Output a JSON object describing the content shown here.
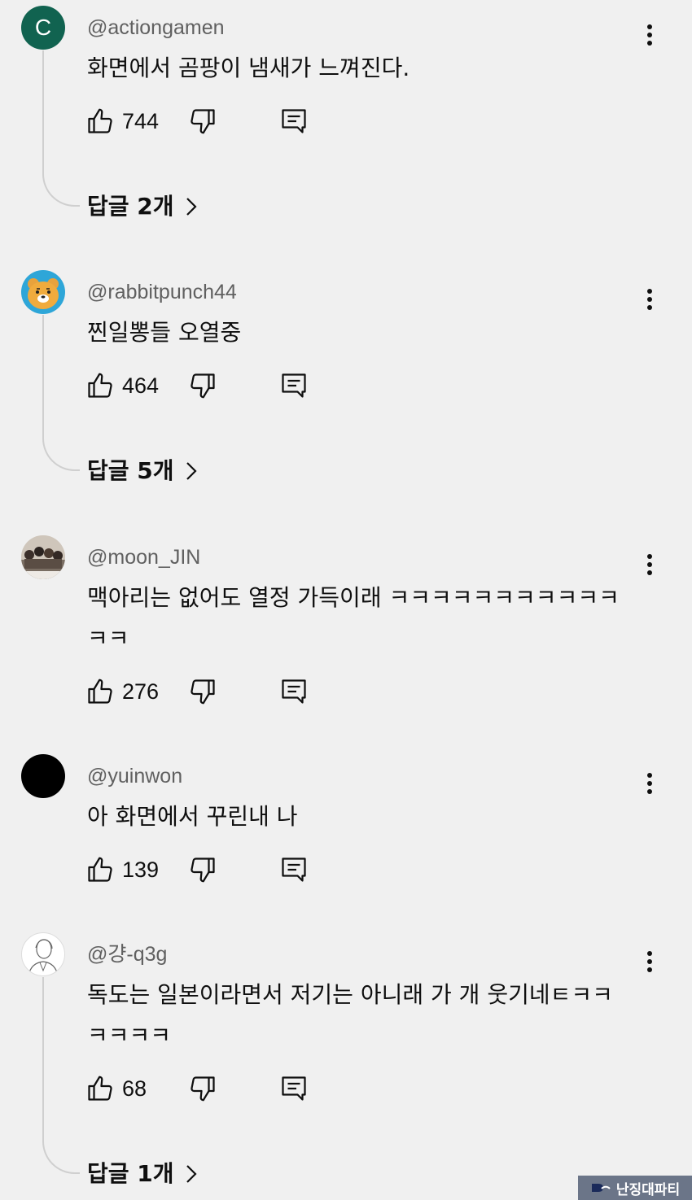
{
  "comments": [
    {
      "handle": "@actiongamen",
      "avatar_letter": "C",
      "text": "화면에서 곰팡이 냄새가 느껴진다.",
      "likes": "744",
      "replies": "답글 2개"
    },
    {
      "handle": "@rabbitpunch44",
      "text": "찐일뽕들 오열중",
      "likes": "464",
      "replies": "답글 5개"
    },
    {
      "handle": "@moon_JIN",
      "text": "맥아리는 없어도 열정 가득이래 ㅋㅋㅋㅋㅋㅋㅋㅋㅋㅋㅋ\nㅋㅋ",
      "likes": "276"
    },
    {
      "handle": "@yuinwon",
      "text": "아 화면에서 꾸린내 나",
      "likes": "139"
    },
    {
      "handle": "@걍-q3g",
      "text": "독도는 일본이라면서 저기는 아니래 가 개 웃기네ㅌㅋㅋ\nㅋㅋㅋㅋ",
      "likes": "68",
      "replies": "답글 1개"
    }
  ],
  "watermark": {
    "text": "난징대파티"
  },
  "colors": {
    "background": "#f0f0f0",
    "avatar_green": "#116350",
    "secondary_text": "#606060"
  },
  "icons": [
    "like-icon",
    "dislike-icon",
    "reply-icon",
    "more-vert-icon",
    "chevron-right-icon"
  ]
}
